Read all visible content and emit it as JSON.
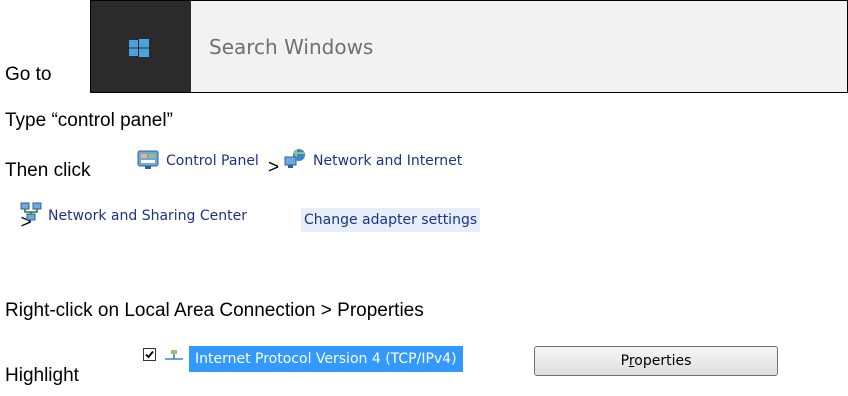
{
  "steps": {
    "goto": "Go to",
    "type": "Type “control panel”",
    "then_click": "Then click",
    "right_click": "Right-click on Local Area Connection > Properties",
    "highlight": "Highlight"
  },
  "separator": ">",
  "search": {
    "placeholder": "Search Windows",
    "tile_color": "#2b2b2b",
    "logo_color": "#4aa3df"
  },
  "breadcrumb": {
    "control_panel": "Control Panel",
    "network_internet": "Network and Internet",
    "network_sharing": "Network and Sharing Center",
    "change_adapter": "Change adapter settings"
  },
  "properties_dialog": {
    "ipv4_item": "Internet Protocol Version 4 (TCP/IPv4)",
    "ipv4_checked": true,
    "properties_button_pre": "P",
    "properties_button_u": "r",
    "properties_button_post": "operties"
  },
  "colors": {
    "link": "#1e3287",
    "selection": "#3399ff",
    "highlight_bg": "#e5eef9"
  }
}
